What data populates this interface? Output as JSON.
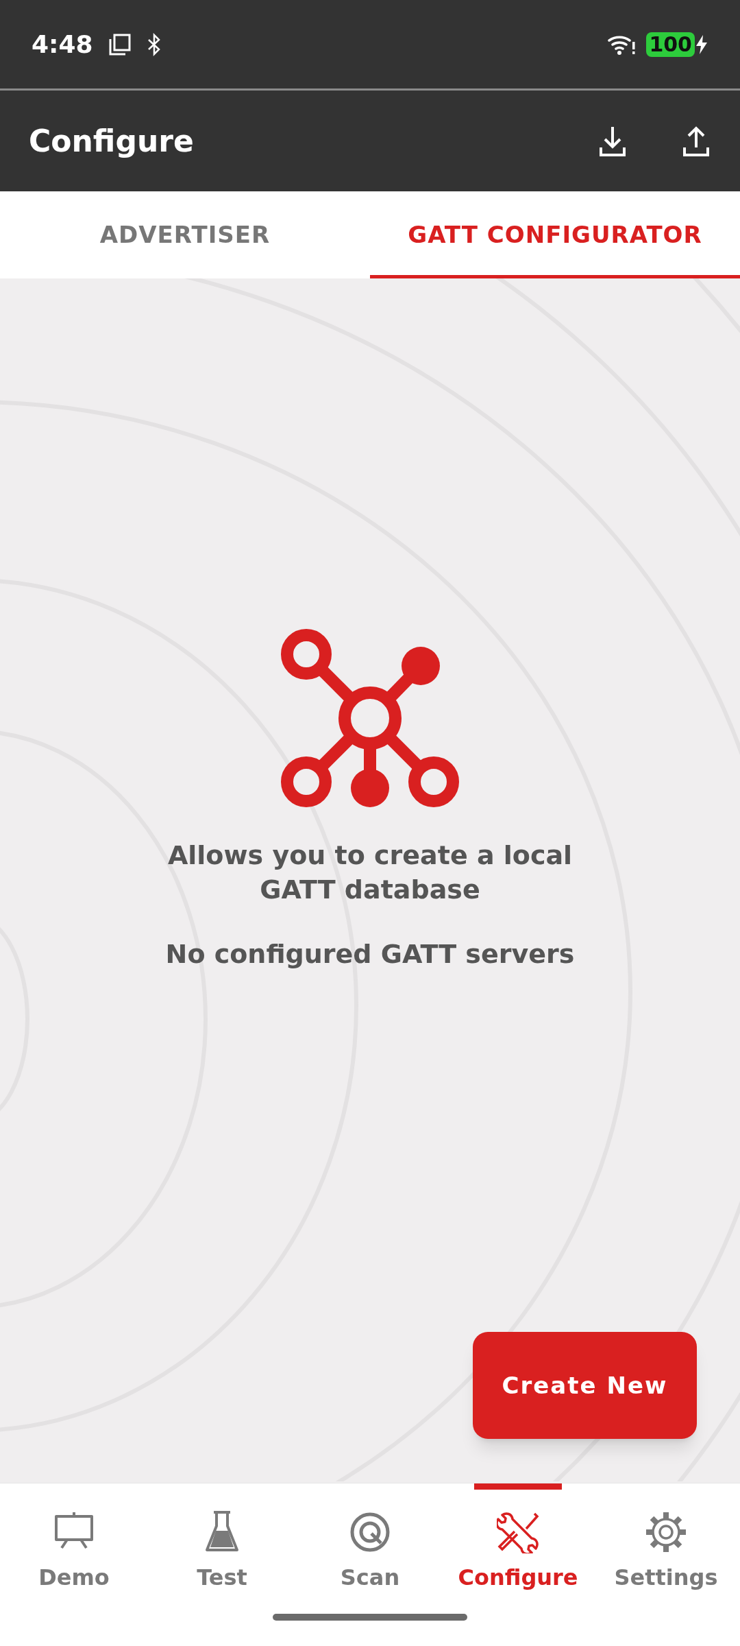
{
  "status_bar": {
    "time": "4:48",
    "battery": "100"
  },
  "app_bar": {
    "title": "Configure"
  },
  "tabs": [
    {
      "label": "ADVERTISER",
      "selected": false
    },
    {
      "label": "GATT CONFIGURATOR",
      "selected": true
    }
  ],
  "empty_state": {
    "message": "Allows you to create a local GATT database",
    "detail": "No configured GATT servers"
  },
  "fab": {
    "label": "Create New"
  },
  "bottom_nav": [
    {
      "label": "Demo",
      "selected": false
    },
    {
      "label": "Test",
      "selected": false
    },
    {
      "label": "Scan",
      "selected": false
    },
    {
      "label": "Configure",
      "selected": true
    },
    {
      "label": "Settings",
      "selected": false
    }
  ]
}
